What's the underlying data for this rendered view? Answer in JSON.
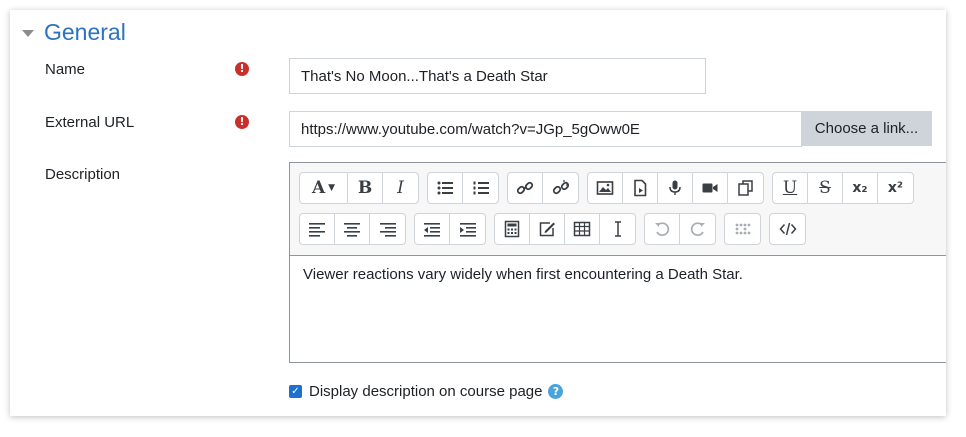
{
  "section": {
    "title": "General"
  },
  "fields": {
    "name": {
      "label": "Name",
      "value": "That's No Moon...That's a Death Star",
      "required_icon": "!"
    },
    "external_url": {
      "label": "External URL",
      "value": "https://www.youtube.com/watch?v=JGp_5gOww0E",
      "required_icon": "!",
      "choose_label": "Choose a link..."
    },
    "description": {
      "label": "Description",
      "content": "Viewer reactions vary widely when first encountering a Death Star.",
      "toolbar": {
        "font": "A",
        "bold": "B",
        "italic": "I",
        "underline": "U",
        "strike": "S",
        "subscript": "x₂",
        "superscript": "x²"
      }
    }
  },
  "display_description": {
    "label": "Display description on course page",
    "checked": true,
    "check_glyph": "✓",
    "help_glyph": "?"
  },
  "colors": {
    "title": "#2b73c2",
    "required": "#c9302c",
    "checkbox": "#1f6fd1",
    "help": "#4aa3d9"
  }
}
